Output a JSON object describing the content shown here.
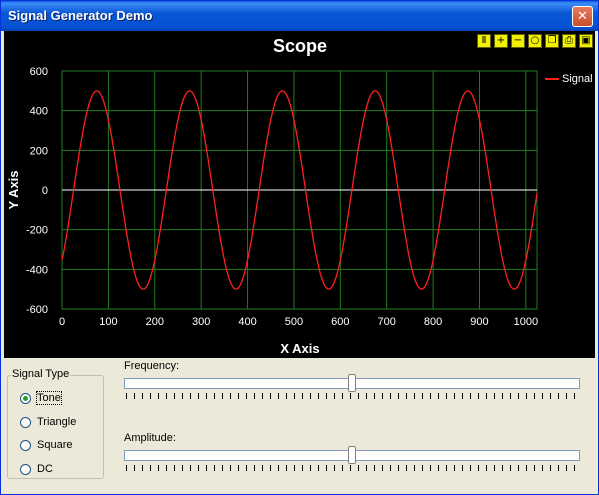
{
  "window": {
    "title": "Signal Generator Demo",
    "close_glyph": "✕"
  },
  "scope": {
    "title": "Scope",
    "toolbar": [
      {
        "name": "pause-icon",
        "glyph": "Ⅱ"
      },
      {
        "name": "zoom-in-icon",
        "glyph": "+"
      },
      {
        "name": "zoom-out-icon",
        "glyph": "−"
      },
      {
        "name": "zoom-reset-icon",
        "glyph": "○"
      },
      {
        "name": "copy-icon",
        "glyph": "❐"
      },
      {
        "name": "print-icon",
        "glyph": "⎙"
      },
      {
        "name": "save-icon",
        "glyph": "▣"
      }
    ],
    "background": "#000000",
    "grid_color": "#1f7f1f",
    "signal_color": "#ff2020"
  },
  "chart_data": {
    "type": "line",
    "title": "Scope",
    "xlabel": "X Axis",
    "ylabel": "Y Axis",
    "xlim": [
      0,
      1024
    ],
    "ylim": [
      -600,
      600
    ],
    "xticks": [
      0,
      100,
      200,
      300,
      400,
      500,
      600,
      700,
      800,
      900,
      1000
    ],
    "yticks": [
      600,
      400,
      200,
      0,
      -200,
      -400,
      -600
    ],
    "grid": true,
    "legend_position": "right",
    "series": [
      {
        "name": "Signal",
        "amplitude": 500,
        "period": 200,
        "phase_x_at_zero": 25,
        "color": "#ff2020"
      }
    ]
  },
  "controls": {
    "signal_type": {
      "label": "Signal Type",
      "options": [
        "Tone",
        "Triangle",
        "Square",
        "DC"
      ],
      "selected": "Tone"
    },
    "frequency": {
      "label": "Frequency:",
      "value_fraction": 0.5
    },
    "amplitude": {
      "label": "Amplitude:",
      "value_fraction": 0.5
    }
  }
}
